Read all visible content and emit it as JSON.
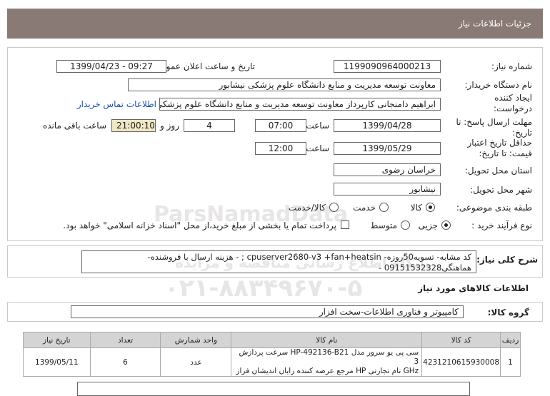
{
  "window_title": "جزئیات اطلاعات نیاز",
  "fields": {
    "need_number_label": "شماره نیاز:",
    "need_number": "1199090964000213",
    "announce_label": "تاریخ و ساعت اعلان عمومی:",
    "announce_value": "1399/04/23 - 09:27",
    "buyer_org_label": "نام دستگاه خریدار:",
    "buyer_org": "معاونت توسعه مدیریت و منابع دانشگاه علوم پزشکی نیشابور",
    "creator_label": "ایجاد کننده درخواست:",
    "creator": "ابراهیم دامنجانی  کارپرداز معاونت توسعه مدیریت و منابع دانشگاه علوم پزشکی",
    "contact_link": "اطلاعات تماس خریدار",
    "deadline_label": "مهلت ارسال پاسخ: تا تاریخ:",
    "deadline_date": "1399/04/28",
    "time_label": "ساعت",
    "deadline_time": "07:00",
    "days_value": "4",
    "days_label": "روز و",
    "remaining_time": "21:00:10",
    "remaining_label": "ساعت باقی مانده",
    "validity_label": "حداقل تاریخ اعتبار قیمت: تا تاریخ:",
    "validity_date": "1399/05/29",
    "validity_time": "12:00",
    "province_label": "استان محل تحویل:",
    "province": "خراسان رضوی",
    "city_label": "شهر محل تحویل:",
    "city": "نیشابور",
    "category_label": "طبقه بندی موضوعی:",
    "category_options": [
      "کالا",
      "خدمت",
      "کالا/خدمت"
    ],
    "category_selected": "کالا",
    "process_label": "نوع فرآیند خرید :",
    "process_options": [
      "جزیی",
      "متوسط"
    ],
    "process_selected": "جزیی",
    "payment_note": "پرداخت تمام یا بخشی از مبلغ خرید،از محل \"اسناد خزانه اسلامی\" خواهد بود."
  },
  "description": {
    "label": "شرح کلی نیاز:",
    "line1": "کد مشابه- تسویه50روزه- cpuserver2680-v3 +fan+heatsin ;    - هزینه ارسال با فروشنده-",
    "line2": "هماهنگی09151532328 -"
  },
  "goods_section_title": "اطلاعات کالاهای مورد نیاز",
  "goods_group": {
    "label": "گروه کالا:",
    "value": "کامپیوتر و فناوری اطلاعات-سخت افزار"
  },
  "table": {
    "headers": [
      "ردیف",
      "کد کالا",
      "نام کالا",
      "واحد شمارش",
      "تعداد",
      "تاریخ نیاز"
    ],
    "rows": [
      {
        "row": "1",
        "code": "4231210615930008",
        "name_line1": "سی پی یو سرور مدل HP-492136-B21 سرعت پردازش 3",
        "name_line2": "GHz نام تجارتی HP مرجع عرضه کننده رایان اندیشان فراز",
        "unit": "عدد",
        "qty": "6",
        "date": "1399/05/11"
      }
    ]
  },
  "watermark": {
    "brand": "ParsNamadData",
    "line1": "پایگاه اطلاع رسانی مناقصه و مزایده",
    "phone": "۰۲۱-۸۸۳۴۹۶۷۰-۵"
  }
}
